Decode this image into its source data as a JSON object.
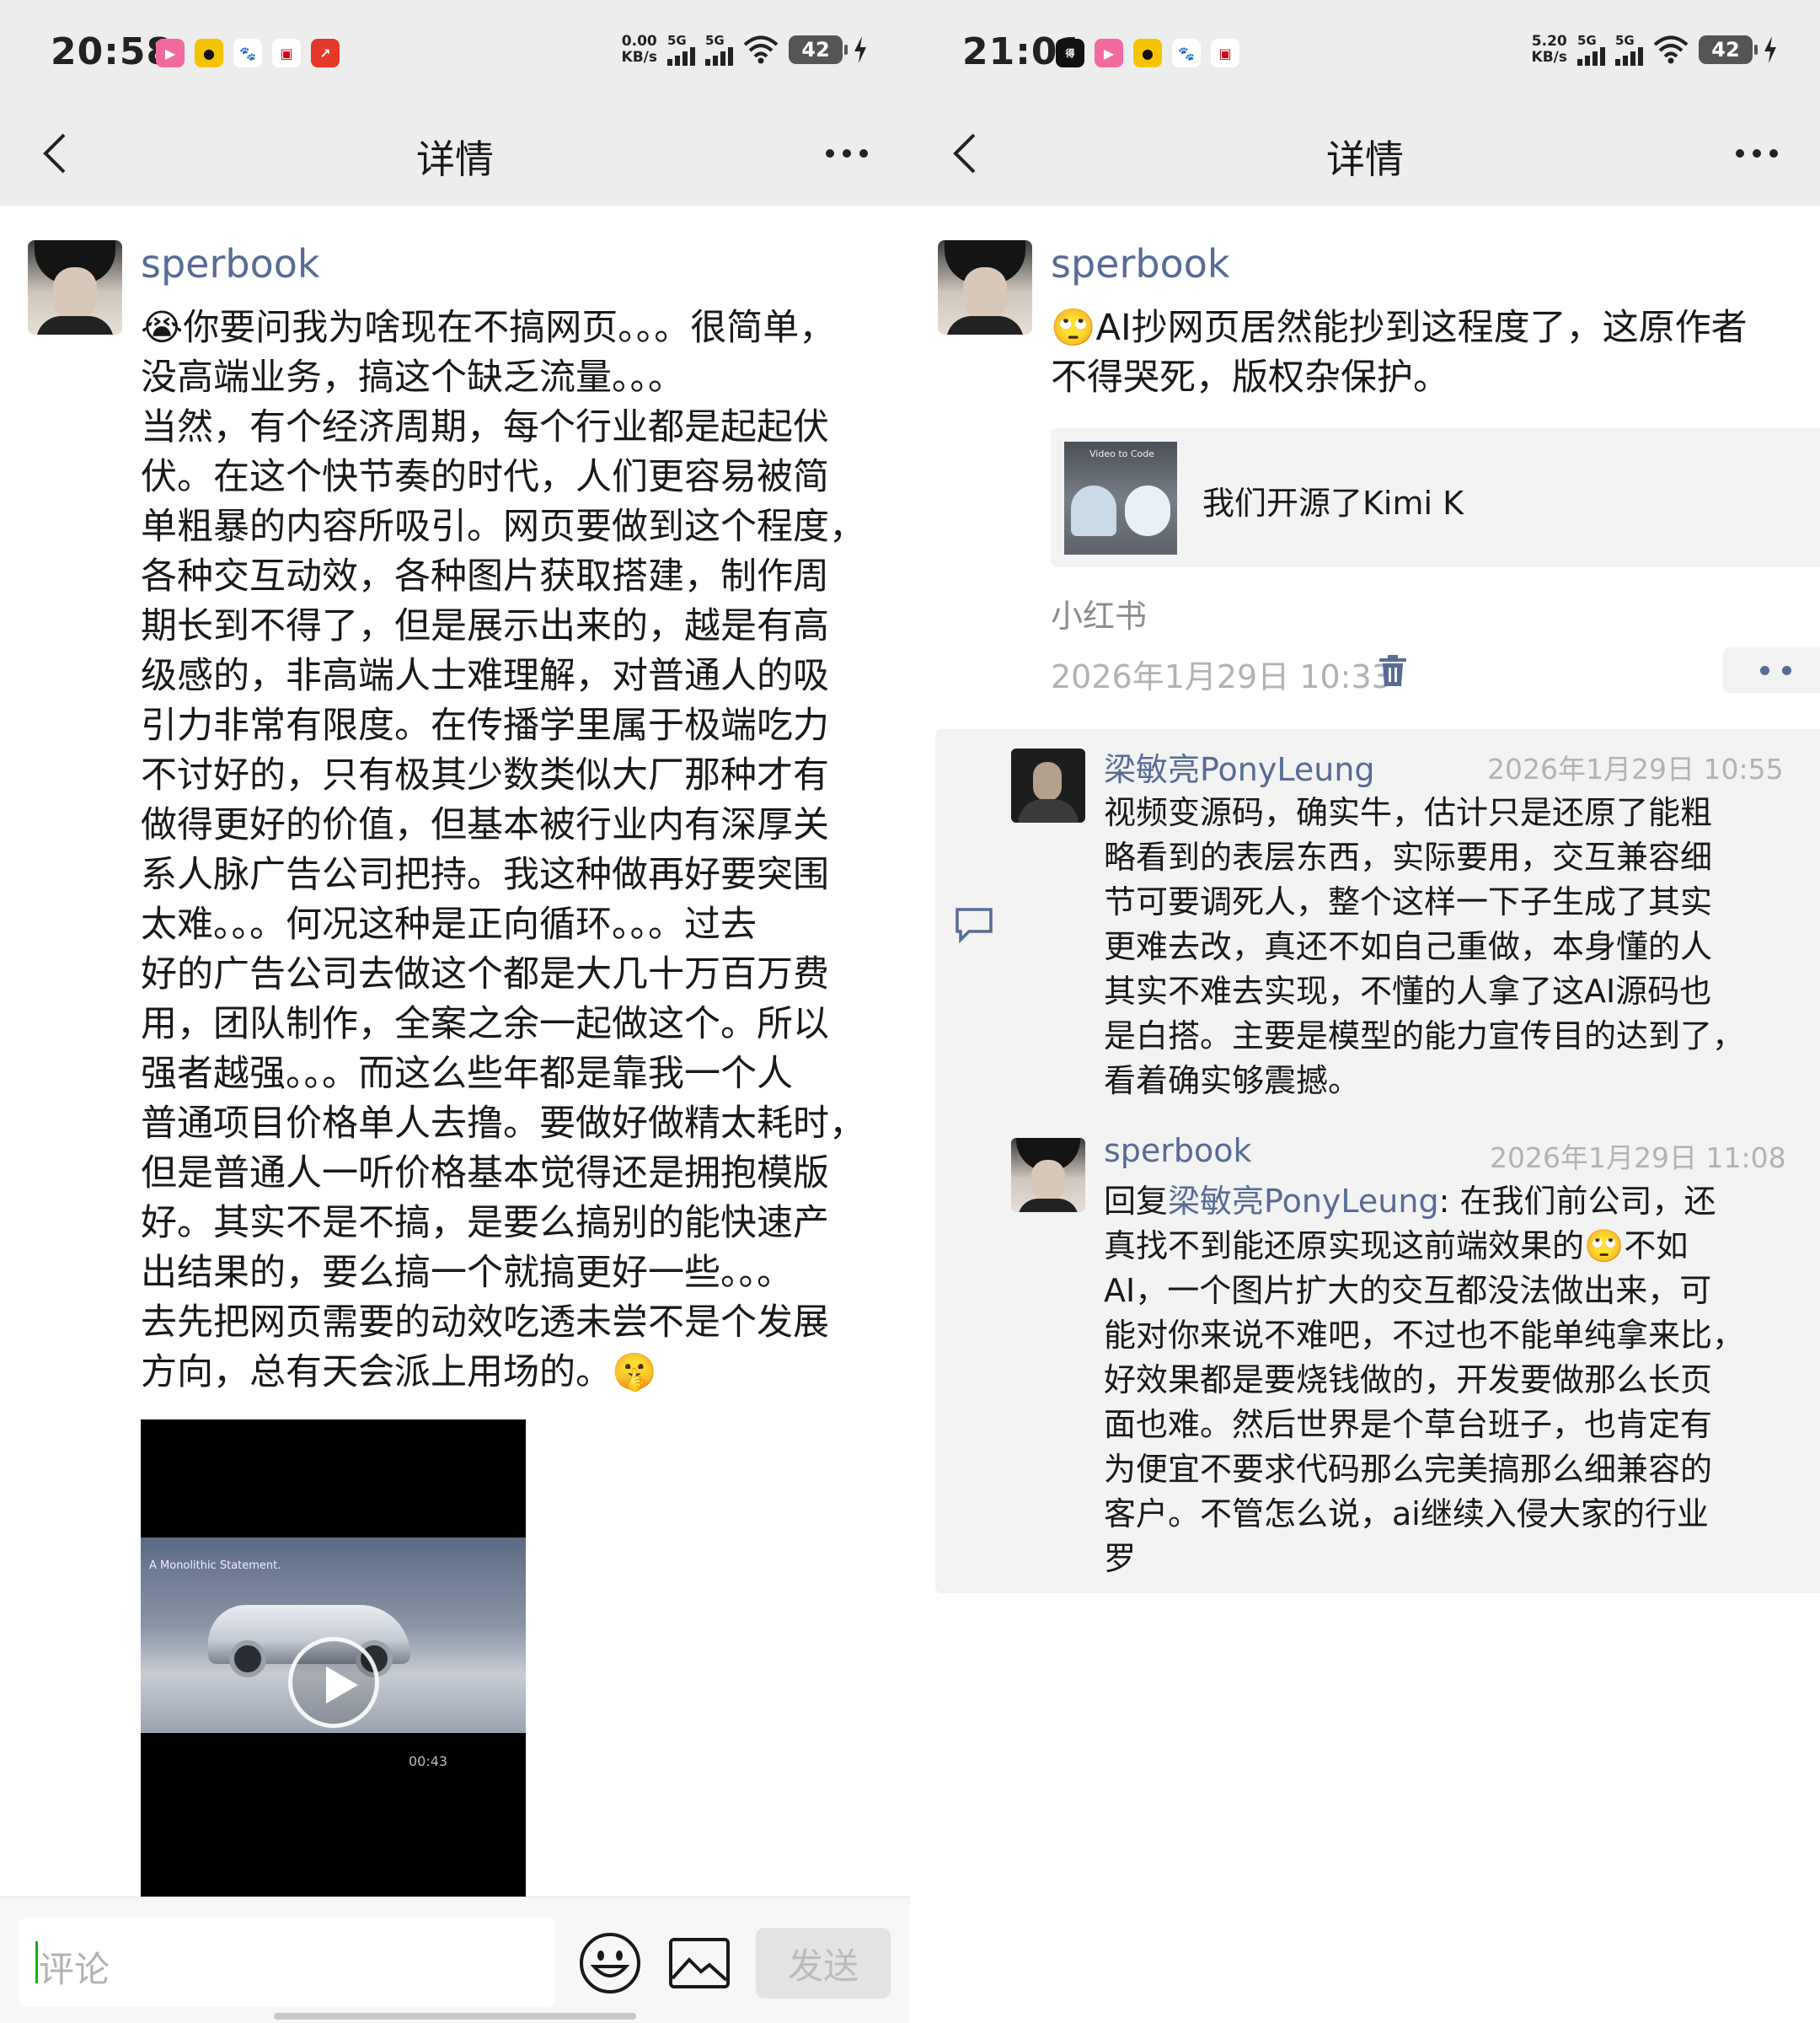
{
  "left": {
    "status": {
      "time": "20:58",
      "net_speed_value": "0.00",
      "net_speed_unit": "KB/s",
      "signal1": "5G",
      "signal2": "5G",
      "battery": "42"
    },
    "nav": {
      "title": "详情"
    },
    "post": {
      "author": "sperbook",
      "text": "😭你要问我为啥现在不搞网页。。。很简单，\n没高端业务，搞这个缺乏流量。。。\n当然，有个经济周期，每个行业都是起起伏\n伏。在这个快节奏的时代，人们更容易被简\n单粗暴的内容所吸引。网页要做到这个程度，\n各种交互动效，各种图片获取搭建，制作周\n期长到不得了，但是展示出来的，越是有高\n级感的，非高端人士难理解，对普通人的吸\n引力非常有限度。在传播学里属于极端吃力\n不讨好的，只有极其少数类似大厂那种才有\n做得更好的价值，但基本被行业内有深厚关\n系人脉广告公司把持。我这种做再好要突围\n太难。。。何况这种是正向循环。。。过去\n好的广告公司去做这个都是大几十万百万费\n用，团队制作，全案之余一起做这个。所以\n强者越强。。。而这么些年都是靠我一个人\n普通项目价格单人去撸。要做好做精太耗时，\n但是普通人一听价格基本觉得还是拥抱模版\n好。其实不是不搞，是要么搞别的能快速产\n出结果的，要么搞一个就搞更好一些。。。\n去先把网页需要的动效吃透未尝不是个发展\n方向，总有天会派上用场的。🤫",
      "video": {
        "caption": "A Monolithic Statement.",
        "duration": "00:43"
      }
    },
    "comment_bar": {
      "placeholder": "评论",
      "send_label": "发送"
    }
  },
  "right": {
    "status": {
      "time": "21:01",
      "net_speed_value": "5.20",
      "net_speed_unit": "KB/s",
      "signal1": "5G",
      "signal2": "5G",
      "battery": "42"
    },
    "nav": {
      "title": "详情"
    },
    "post": {
      "author": "sperbook",
      "text": "🙄AI抄网页居然能抄到这程度了，这原作者\n不得哭死，版权杂保护。",
      "link_card": {
        "thumb_text": "Video to Code",
        "title": "我们开源了Kimi K"
      },
      "source": "小红书",
      "time": "2026年1月29日 10:33"
    },
    "comments": [
      {
        "author": "梁敏亮PonyLeung",
        "time": "2026年1月29日 10:55",
        "text": "视频变源码，确实牛，估计只是还原了能粗\n略看到的表层东西，实际要用，交互兼容细\n节可要调死人，整个这样一下子生成了其实\n更难去改，真还不如自己重做，本身懂的人\n其实不难去实现，不懂的人拿了这AI源码也\n是白搭。主要是模型的能力宣传目的达到了，\n看着确实够震撼。"
      },
      {
        "author": "sperbook",
        "time": "2026年1月29日 11:08",
        "reply_prefix": "回复",
        "reply_to": "梁敏亮PonyLeung",
        "text": ": 在我们前公司，还\n真找不到能还原实现这前端效果的🙄不如\nAI，一个图片扩大的交互都没法做出来，可\n能对你来说不难吧，不过也不能单纯拿来比，\n好效果都是要烧钱做的，开发要做那么长页\n面也难。然后世界是个草台班子，也肯定有\n为便宜不要求代码那么完美搞那么细兼容的\n客户。不管怎么说，ai继续入侵大家的行业\n罗"
      }
    ]
  }
}
